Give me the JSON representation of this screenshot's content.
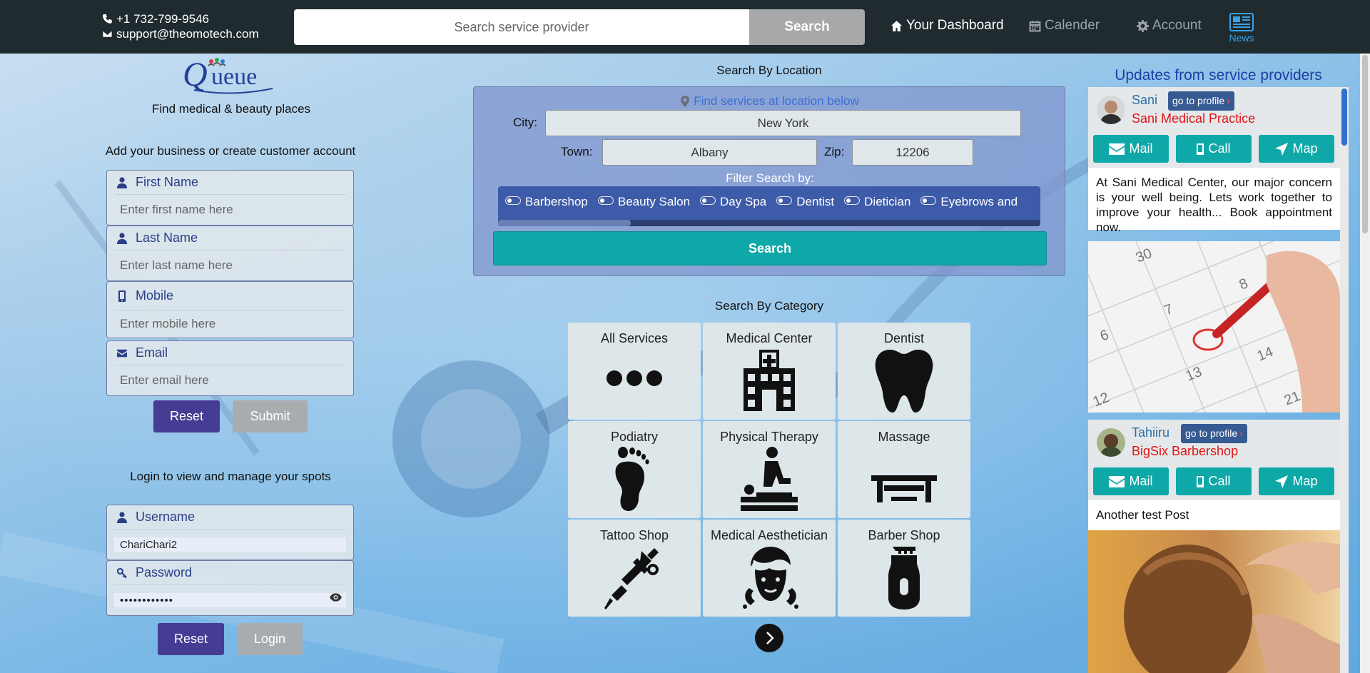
{
  "header": {
    "phone": "+1 732-799-9546",
    "email": "support@theomotech.com",
    "search_placeholder": "Search service provider",
    "search_button": "Search",
    "nav_dashboard": "Your Dashboard",
    "nav_calendar": "Calender",
    "nav_account": "Account",
    "nav_news": "News"
  },
  "left": {
    "tagline": "Find medical & beauty places",
    "register_title": "Add your business or create customer account",
    "first_name_label": "First Name",
    "first_name_placeholder": "Enter first name here",
    "last_name_label": "Last Name",
    "last_name_placeholder": "Enter last name here",
    "mobile_label": "Mobile",
    "mobile_placeholder": "Enter mobile here",
    "email_label": "Email",
    "email_placeholder": "Enter email here",
    "reset_label": "Reset",
    "submit_label": "Submit",
    "login_title": "Login to view and manage your spots",
    "username_label": "Username",
    "username_value": "ChariChari2",
    "password_label": "Password",
    "password_value": "••••••••••••",
    "login_reset_label": "Reset",
    "login_label": "Login"
  },
  "location": {
    "title": "Search By Location",
    "hint": "Find services at location below",
    "city_label": "City:",
    "city_value": "New York",
    "town_label": "Town:",
    "town_value": "Albany",
    "zip_label": "Zip:",
    "zip_value": "12206",
    "filter_title": "Filter Search by:",
    "filters": [
      "Barbershop",
      "Beauty Salon",
      "Day Spa",
      "Dentist",
      "Dietician",
      "Eyebrows and"
    ],
    "search_button": "Search"
  },
  "category": {
    "title": "Search By Category",
    "items": [
      {
        "label": "All Services",
        "icon": "dots-icon"
      },
      {
        "label": "Medical Center",
        "icon": "hospital-icon"
      },
      {
        "label": "Dentist",
        "icon": "tooth-icon"
      },
      {
        "label": "Podiatry",
        "icon": "foot-icon"
      },
      {
        "label": "Physical Therapy",
        "icon": "massage-therapy-icon"
      },
      {
        "label": "Massage",
        "icon": "massage-table-icon"
      },
      {
        "label": "Tattoo Shop",
        "icon": "tattoo-machine-icon"
      },
      {
        "label": "Medical Aesthetician",
        "icon": "face-icon"
      },
      {
        "label": "Barber Shop",
        "icon": "clipper-icon"
      }
    ]
  },
  "updates": {
    "title": "Updates from service providers",
    "posts": [
      {
        "name": "Sani",
        "profile_link": "go to profile",
        "business": "Sani Medical Practice",
        "mail": "Mail",
        "call": "Call",
        "map": "Map",
        "text": "At Sani Medical Center, our major concern is your well being. Lets work together to improve your health... Book appointment now."
      },
      {
        "name": "Tahiiru",
        "profile_link": "go to profile",
        "business": "BigSix Barbershop",
        "mail": "Mail",
        "call": "Call",
        "map": "Map",
        "text": "Another test Post"
      }
    ]
  },
  "colors": {
    "topbar": "#1f2b2e",
    "accent_teal": "#0fa8a8",
    "reset_purple": "#463c93",
    "link_blue": "#1c3fa3",
    "business_red": "#e01515"
  }
}
